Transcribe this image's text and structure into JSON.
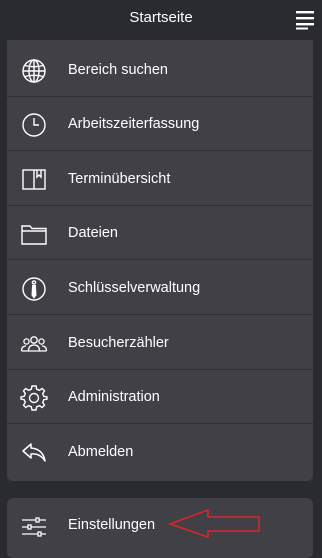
{
  "header": {
    "title": "Startseite",
    "menu_icon": "hamburger-menu-icon"
  },
  "menu": {
    "items": [
      {
        "label": "Bereich suchen",
        "icon": "globe-icon"
      },
      {
        "label": "Arbeitszeiterfassung",
        "icon": "clock-icon"
      },
      {
        "label": "Terminübersicht",
        "icon": "book-icon"
      },
      {
        "label": "Dateien",
        "icon": "folder-icon"
      },
      {
        "label": "Schlüsselverwaltung",
        "icon": "key-icon"
      },
      {
        "label": "Besucherzähler",
        "icon": "people-icon"
      },
      {
        "label": "Administration",
        "icon": "gear-icon"
      },
      {
        "label": "Abmelden",
        "icon": "logout-arrow-icon"
      }
    ]
  },
  "settings": {
    "label": "Einstellungen",
    "icon": "sliders-icon"
  },
  "annotation": {
    "icon": "red-arrow-annotation",
    "color": "#d9262a"
  },
  "colors": {
    "background": "#2a2b30",
    "card": "#404046",
    "text": "#ffffff"
  }
}
